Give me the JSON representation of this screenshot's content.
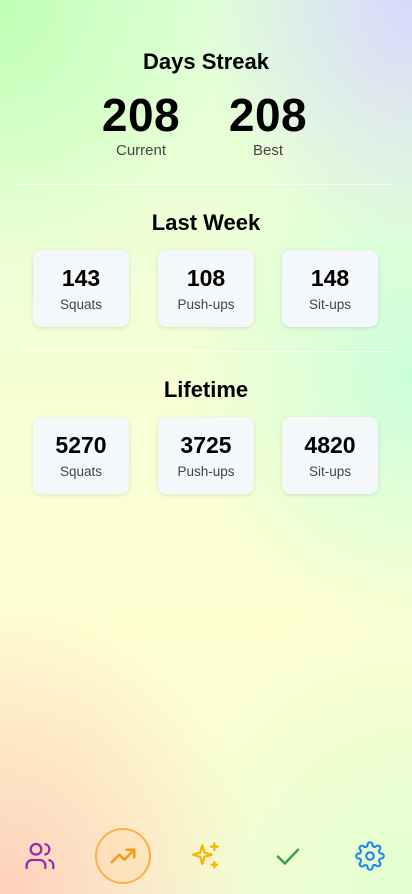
{
  "streak": {
    "title": "Days Streak",
    "current": {
      "value": "208",
      "label": "Current"
    },
    "best": {
      "value": "208",
      "label": "Best"
    }
  },
  "last_week": {
    "title": "Last Week",
    "stats": [
      {
        "value": "143",
        "label": "Squats"
      },
      {
        "value": "108",
        "label": "Push-ups"
      },
      {
        "value": "148",
        "label": "Sit-ups"
      }
    ]
  },
  "lifetime": {
    "title": "Lifetime",
    "stats": [
      {
        "value": "5270",
        "label": "Squats"
      },
      {
        "value": "3725",
        "label": "Push-ups"
      },
      {
        "value": "4820",
        "label": "Sit-ups"
      }
    ]
  },
  "nav": {
    "items": [
      {
        "icon": "users-icon",
        "color": "#9c27b0"
      },
      {
        "icon": "trending-up-icon",
        "color": "#f39c12",
        "active": true
      },
      {
        "icon": "sparkles-icon",
        "color": "#f5b400"
      },
      {
        "icon": "check-icon",
        "color": "#43a047"
      },
      {
        "icon": "gear-icon",
        "color": "#1e88e5"
      }
    ]
  }
}
